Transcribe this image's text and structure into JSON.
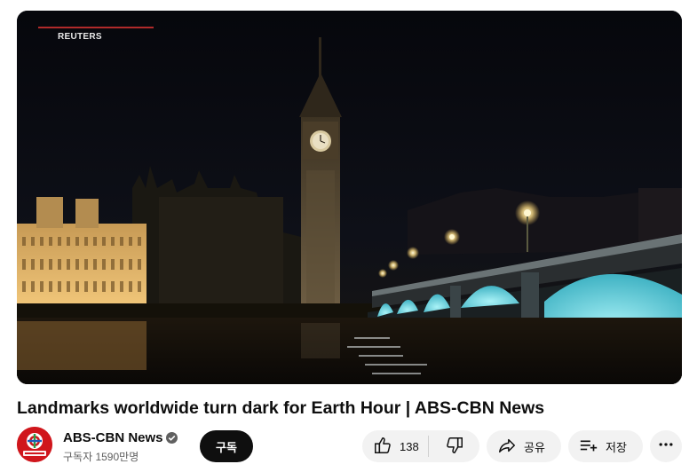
{
  "video": {
    "watermark": "REUTERS"
  },
  "title": "Landmarks worldwide turn dark for Earth Hour | ABS-CBN News",
  "channel": {
    "name": "ABS-CBN News",
    "subscribers": "구독자 1590만명",
    "avatar_text": "ABS-CBN NEWS",
    "verified_icon": "check-circle-icon"
  },
  "actions": {
    "subscribe": "구독",
    "like_count": "138",
    "share": "공유",
    "save": "저장"
  },
  "icons": {
    "like": "thumbs-up-icon",
    "dislike": "thumbs-down-icon",
    "share": "share-arrow-icon",
    "save": "playlist-add-icon",
    "more": "more-horizontal-icon"
  },
  "colors": {
    "subscribe_bg": "#0f0f0f",
    "pill_bg": "#f2f2f2",
    "avatar_bg": "#d0161c",
    "bridge_light": "#7fe6ef"
  }
}
